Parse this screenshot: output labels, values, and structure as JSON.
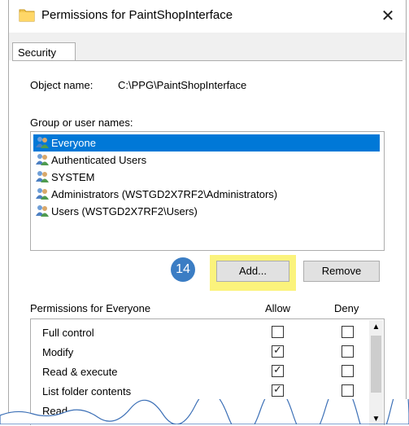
{
  "window": {
    "title": "Permissions for PaintShopInterface",
    "close_glyph": "✕"
  },
  "tabs": [
    {
      "label": "Security"
    }
  ],
  "object": {
    "label": "Object name:",
    "value": "C:\\PPG\\PaintShopInterface"
  },
  "group_label": "Group or user names:",
  "users": [
    {
      "name": "Everyone",
      "selected": true
    },
    {
      "name": "Authenticated Users",
      "selected": false
    },
    {
      "name": "SYSTEM",
      "selected": false
    },
    {
      "name": "Administrators (WSTGD2X7RF2\\Administrators)",
      "selected": false
    },
    {
      "name": "Users (WSTGD2X7RF2\\Users)",
      "selected": false
    }
  ],
  "callout_number": "14",
  "buttons": {
    "add": "Add...",
    "remove": "Remove"
  },
  "permissions": {
    "header": "Permissions for Everyone",
    "allow_header": "Allow",
    "deny_header": "Deny",
    "rows": [
      {
        "name": "Full control",
        "allow": false,
        "deny": false
      },
      {
        "name": "Modify",
        "allow": true,
        "deny": false
      },
      {
        "name": "Read & execute",
        "allow": true,
        "deny": false
      },
      {
        "name": "List folder contents",
        "allow": true,
        "deny": false
      },
      {
        "name": "Read",
        "allow": true,
        "deny": false
      }
    ]
  },
  "colors": {
    "selection": "#0078d7",
    "highlight": "#fbf37c",
    "callout": "#3b7dc4"
  }
}
